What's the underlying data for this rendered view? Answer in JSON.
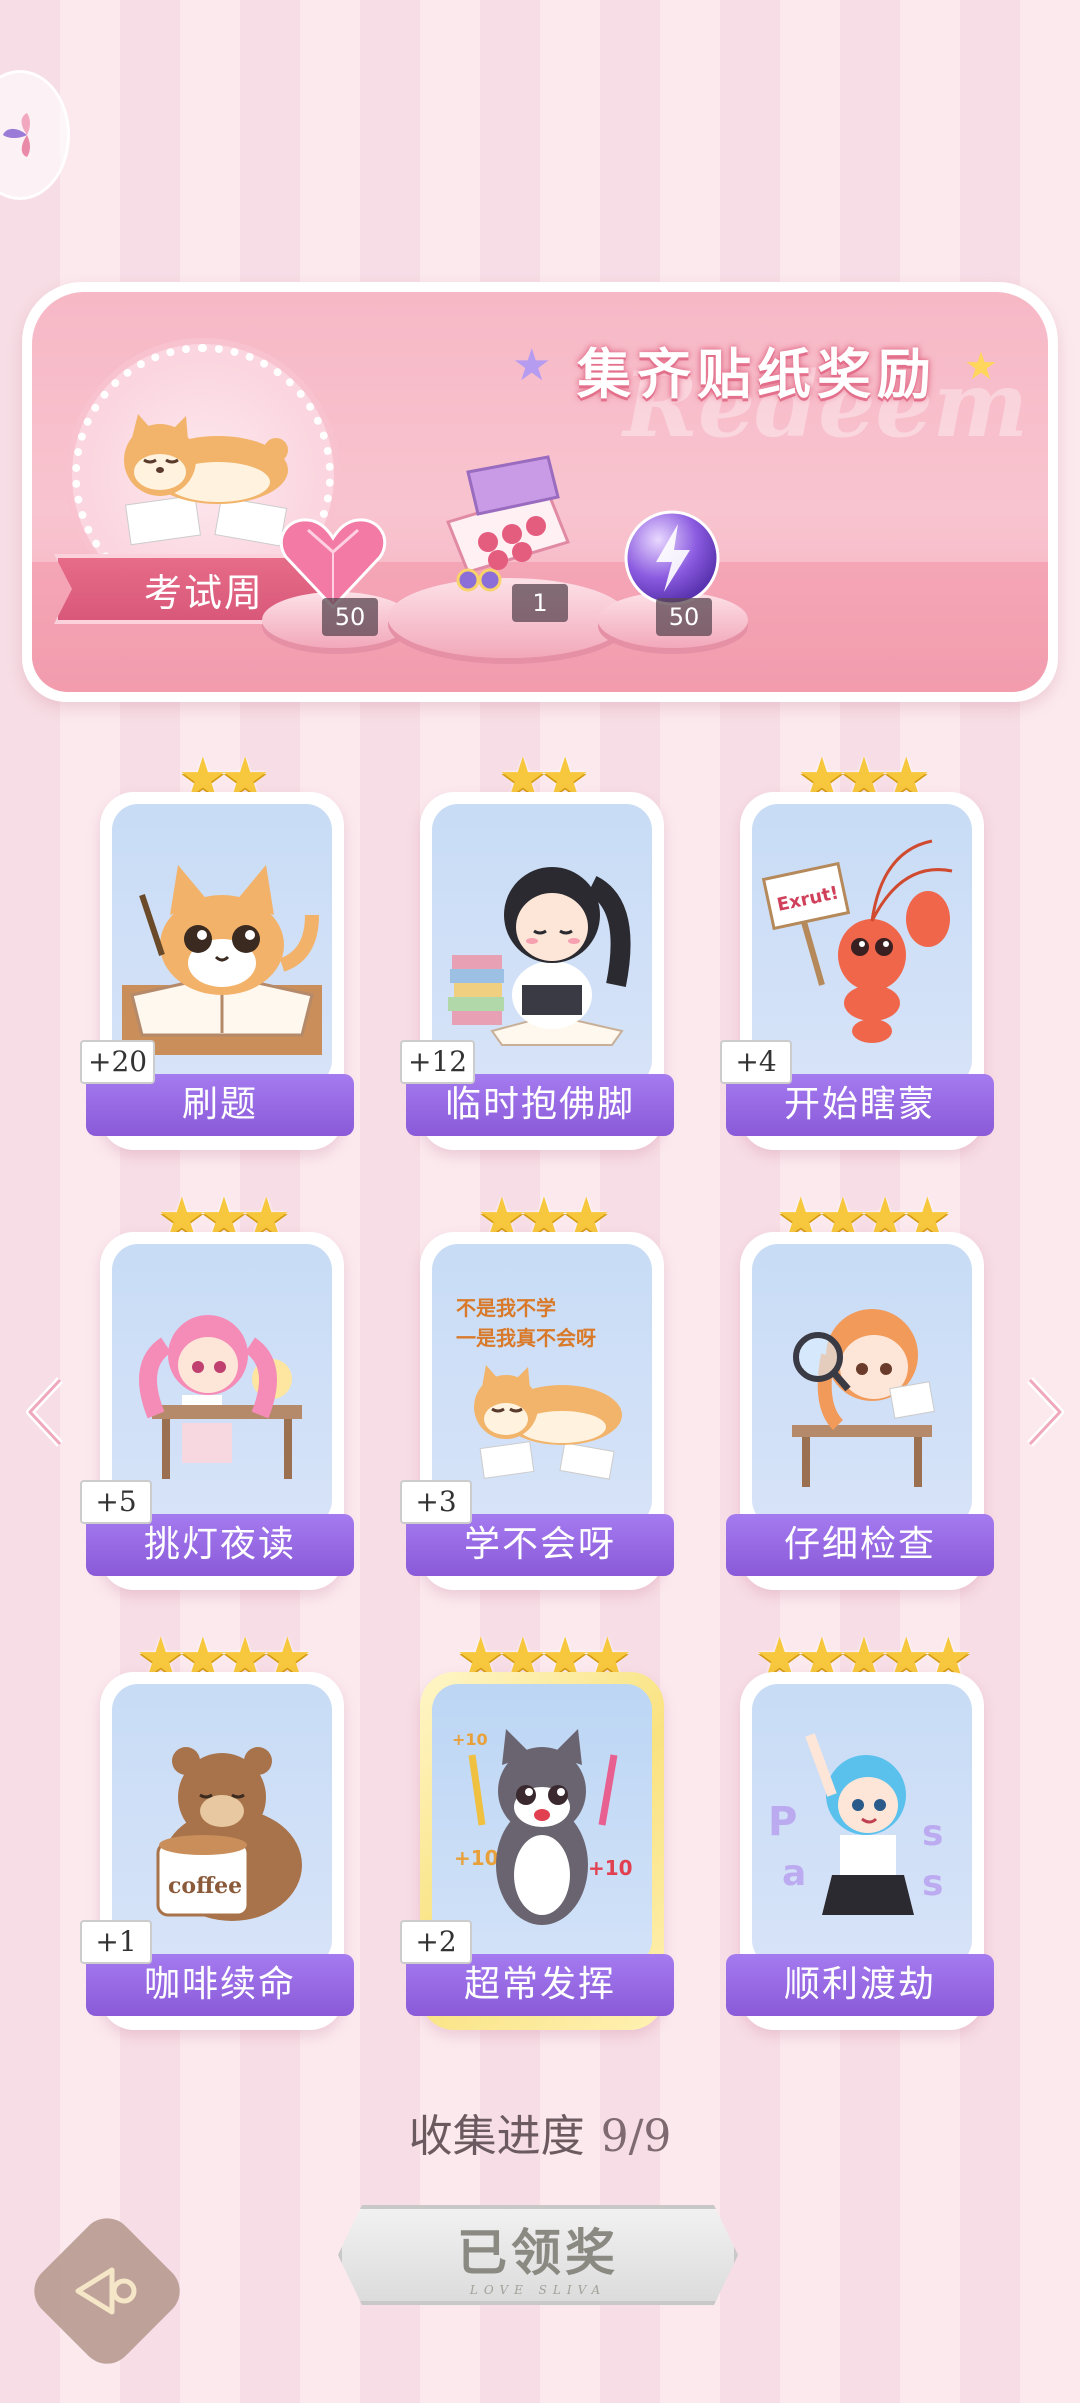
{
  "banner": {
    "title": "集齐贴纸奖励",
    "watermark": "Redeem",
    "theme_label": "考试周",
    "rewards": [
      {
        "icon": "pink-heart-gem-icon",
        "count": "50"
      },
      {
        "icon": "gift-box-icon",
        "count": "1"
      },
      {
        "icon": "purple-energy-orb-icon",
        "count": "50"
      }
    ]
  },
  "stickers": [
    {
      "name": "刷题",
      "plus": "+20",
      "stars": 2,
      "icon": "cat-studying-sticker"
    },
    {
      "name": "临时抱佛脚",
      "plus": "+12",
      "stars": 2,
      "icon": "girl-cramming-sticker"
    },
    {
      "name": "开始瞎蒙",
      "plus": "+4",
      "stars": 3,
      "icon": "lobster-guessing-sticker"
    },
    {
      "name": "挑灯夜读",
      "plus": "+5",
      "stars": 3,
      "icon": "girl-night-reading-sticker"
    },
    {
      "name": "学不会呀",
      "plus": "+3",
      "stars": 3,
      "icon": "shiba-lying-sticker",
      "caption_lines": [
        "不是我不学",
        "一是我真不会呀"
      ]
    },
    {
      "name": "仔细检查",
      "plus": "",
      "stars": 4,
      "icon": "girl-magnifier-sticker"
    },
    {
      "name": "咖啡续命",
      "plus": "+1",
      "stars": 4,
      "icon": "bear-coffee-sticker",
      "mug_text": "coffee"
    },
    {
      "name": "超常发挥",
      "plus": "+2",
      "stars": 4,
      "icon": "cat-pencils-sticker",
      "gold": true,
      "score_marks": [
        "+10",
        "+10",
        "+10"
      ]
    },
    {
      "name": "顺利渡劫",
      "plus": "",
      "stars": 5,
      "icon": "girl-pass-sticker",
      "bubble_letters": [
        "P",
        "a",
        "s",
        "s"
      ]
    }
  ],
  "lobster_sign": "Exrut!",
  "progress": {
    "label": "收集进度",
    "value": "9/9"
  },
  "claim_button": {
    "label": "已领奖",
    "sub": "LOVE SLIVA"
  },
  "colors": {
    "accent": "#8a5ad8",
    "banner_pink": "#f7b8c6",
    "star": "#f7c73d"
  }
}
